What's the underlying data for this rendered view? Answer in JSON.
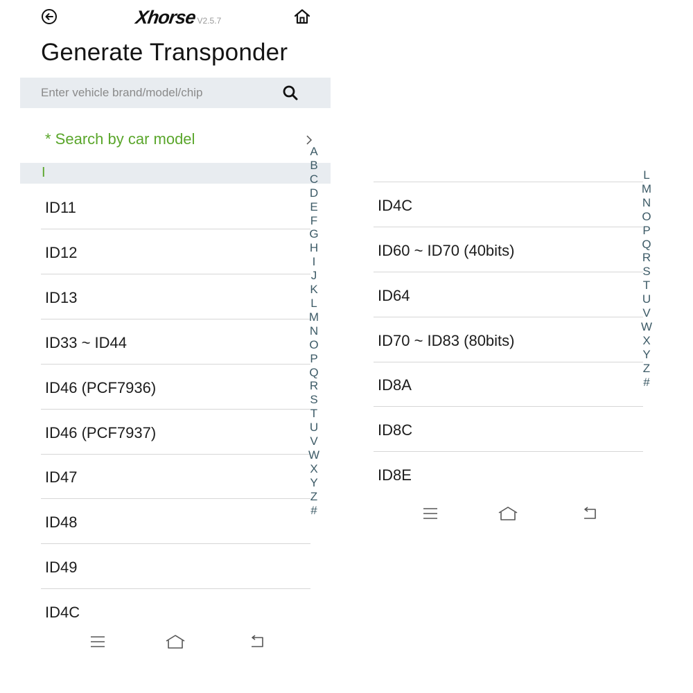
{
  "app": {
    "logo": "Xhorse",
    "version": "V2.5.7"
  },
  "page_title": "Generate Transponder",
  "search": {
    "placeholder": "Enter vehicle brand/model/chip",
    "value": ""
  },
  "search_by_model": "* Search by car model",
  "section_letter": "I",
  "left_list": [
    "ID11",
    "ID12",
    "ID13",
    "ID33 ~ ID44",
    "ID46 (PCF7936)",
    "ID46 (PCF7937)",
    "ID47",
    "ID48",
    "ID49",
    "ID4C"
  ],
  "right_list": [
    "ID4C",
    "ID60 ~ ID70 (40bits)",
    "ID64",
    "ID70 ~ ID83 (80bits)",
    "ID8A",
    "ID8C",
    "ID8E"
  ],
  "left_index": [
    "A",
    "B",
    "C",
    "D",
    "E",
    "F",
    "G",
    "H",
    "I",
    "J",
    "K",
    "L",
    "M",
    "N",
    "O",
    "P",
    "Q",
    "R",
    "S",
    "T",
    "U",
    "V",
    "W",
    "X",
    "Y",
    "Z",
    "#"
  ],
  "right_index": [
    "L",
    "M",
    "N",
    "O",
    "P",
    "Q",
    "R",
    "S",
    "T",
    "U",
    "V",
    "W",
    "X",
    "Y",
    "Z",
    "#"
  ],
  "colors": {
    "accent_green": "#5aa62b",
    "search_bg": "#e8ecf0",
    "index_text": "#3c5a66",
    "divider": "#d6d6d6"
  },
  "icons": {
    "back": "back-arrow-icon",
    "home": "home-icon",
    "search": "search-icon",
    "chevron": "chevron-right-icon",
    "nav_menu": "menu-icon",
    "nav_home": "home-outline-icon",
    "nav_back": "return-icon"
  }
}
